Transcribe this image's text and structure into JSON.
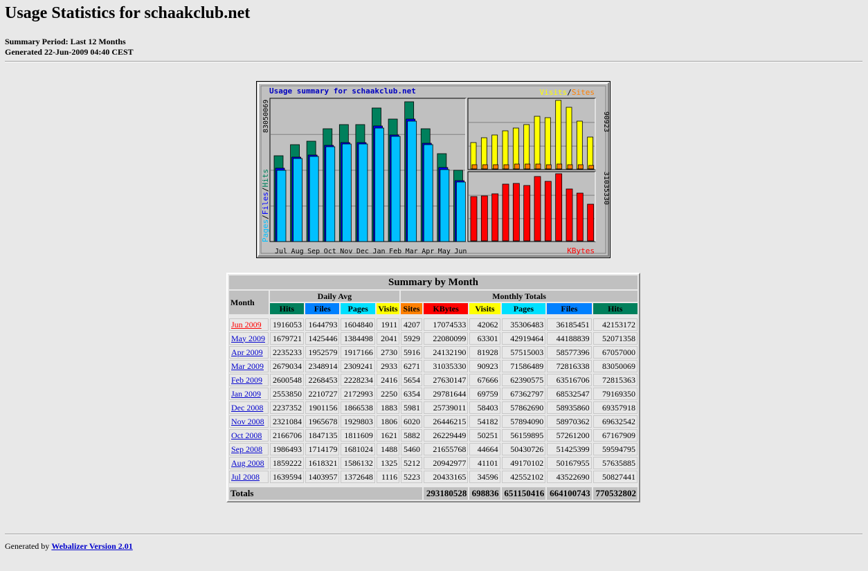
{
  "header": {
    "title": "Usage Statistics for schaakclub.net",
    "period": "Summary Period: Last 12 Months",
    "generated": "Generated 22-Jun-2009 04:40 CEST"
  },
  "graph": {
    "title": "Usage summary for schaakclub.net",
    "left_legend": [
      "Pages",
      "/",
      "Files",
      "/",
      "Hits"
    ],
    "right_top_legend": [
      "Visits",
      "/",
      "Sites"
    ],
    "right_bottom_legend": "KBytes",
    "left_max_label": "83050069",
    "right_top_max_label": "90923",
    "right_bottom_max_label": "31035330",
    "colors": {
      "hits": "#00805c",
      "files": "#0000ff",
      "pages": "#00c0ff",
      "visits": "#ffff00",
      "sites": "#ff8000",
      "kbytes": "#ff0000",
      "title": "#0000c0"
    }
  },
  "chart_data": {
    "type": "bar",
    "categories": [
      "Jul",
      "Aug",
      "Sep",
      "Oct",
      "Nov",
      "Dec",
      "Jan",
      "Feb",
      "Mar",
      "Apr",
      "May",
      "Jun"
    ],
    "series": [
      {
        "name": "Hits",
        "values": [
          50827441,
          57635885,
          59594795,
          67167909,
          69632542,
          69357918,
          79169350,
          72815363,
          83050069,
          67057000,
          52071358,
          42153172
        ]
      },
      {
        "name": "Files",
        "values": [
          43522690,
          50167955,
          51425399,
          57261200,
          58970362,
          58935860,
          68532547,
          63516706,
          72816338,
          58577396,
          44188839,
          36185451
        ]
      },
      {
        "name": "Pages",
        "values": [
          42552102,
          49170102,
          50430726,
          56159895,
          57894090,
          57862690,
          67362797,
          62390575,
          71586489,
          57515003,
          42919464,
          35306483
        ]
      },
      {
        "name": "Visits",
        "values": [
          34596,
          41101,
          44664,
          50251,
          54182,
          58403,
          69759,
          67666,
          90923,
          81928,
          63301,
          42062
        ]
      },
      {
        "name": "Sites",
        "values": [
          5223,
          5212,
          5460,
          5882,
          6020,
          5981,
          6354,
          5654,
          6271,
          5916,
          5929,
          4207
        ]
      },
      {
        "name": "KBytes",
        "values": [
          20433165,
          20942977,
          21655768,
          26229449,
          26446215,
          25739011,
          29781644,
          27630147,
          31035330,
          24132190,
          22080099,
          17074533
        ]
      }
    ],
    "ylim_left": [
      0,
      83050069
    ],
    "ylim_visits": [
      0,
      90923
    ],
    "ylim_kbytes": [
      0,
      31035330
    ],
    "grid": true
  },
  "table": {
    "caption": "Summary by Month",
    "month_header": "Month",
    "daily_avg_header": "Daily Avg",
    "monthly_totals_header": "Monthly Totals",
    "daily_cols": [
      {
        "label": "Hits",
        "color": "#00805c"
      },
      {
        "label": "Files",
        "color": "#0080ff"
      },
      {
        "label": "Pages",
        "color": "#00e0ff"
      },
      {
        "label": "Visits",
        "color": "#ffff00"
      }
    ],
    "monthly_cols": [
      {
        "label": "Sites",
        "color": "#ff8000"
      },
      {
        "label": "KBytes",
        "color": "#ff0000"
      },
      {
        "label": "Visits",
        "color": "#ffff00"
      },
      {
        "label": "Pages",
        "color": "#00e0ff"
      },
      {
        "label": "Files",
        "color": "#0080ff"
      },
      {
        "label": "Hits",
        "color": "#00805c"
      }
    ],
    "rows": [
      {
        "month": "Jun 2009",
        "current": true,
        "values": [
          "1916053",
          "1644793",
          "1604840",
          "1911",
          "4207",
          "17074533",
          "42062",
          "35306483",
          "36185451",
          "42153172"
        ]
      },
      {
        "month": "May 2009",
        "values": [
          "1679721",
          "1425446",
          "1384498",
          "2041",
          "5929",
          "22080099",
          "63301",
          "42919464",
          "44188839",
          "52071358"
        ]
      },
      {
        "month": "Apr 2009",
        "values": [
          "2235233",
          "1952579",
          "1917166",
          "2730",
          "5916",
          "24132190",
          "81928",
          "57515003",
          "58577396",
          "67057000"
        ]
      },
      {
        "month": "Mar 2009",
        "values": [
          "2679034",
          "2348914",
          "2309241",
          "2933",
          "6271",
          "31035330",
          "90923",
          "71586489",
          "72816338",
          "83050069"
        ]
      },
      {
        "month": "Feb 2009",
        "values": [
          "2600548",
          "2268453",
          "2228234",
          "2416",
          "5654",
          "27630147",
          "67666",
          "62390575",
          "63516706",
          "72815363"
        ]
      },
      {
        "month": "Jan 2009",
        "values": [
          "2553850",
          "2210727",
          "2172993",
          "2250",
          "6354",
          "29781644",
          "69759",
          "67362797",
          "68532547",
          "79169350"
        ]
      },
      {
        "month": "Dec 2008",
        "values": [
          "2237352",
          "1901156",
          "1866538",
          "1883",
          "5981",
          "25739011",
          "58403",
          "57862690",
          "58935860",
          "69357918"
        ]
      },
      {
        "month": "Nov 2008",
        "values": [
          "2321084",
          "1965678",
          "1929803",
          "1806",
          "6020",
          "26446215",
          "54182",
          "57894090",
          "58970362",
          "69632542"
        ]
      },
      {
        "month": "Oct 2008",
        "values": [
          "2166706",
          "1847135",
          "1811609",
          "1621",
          "5882",
          "26229449",
          "50251",
          "56159895",
          "57261200",
          "67167909"
        ]
      },
      {
        "month": "Sep 2008",
        "values": [
          "1986493",
          "1714179",
          "1681024",
          "1488",
          "5460",
          "21655768",
          "44664",
          "50430726",
          "51425399",
          "59594795"
        ]
      },
      {
        "month": "Aug 2008",
        "values": [
          "1859222",
          "1618321",
          "1586132",
          "1325",
          "5212",
          "20942977",
          "41101",
          "49170102",
          "50167955",
          "57635885"
        ]
      },
      {
        "month": "Jul 2008",
        "values": [
          "1639594",
          "1403957",
          "1372648",
          "1116",
          "5223",
          "20433165",
          "34596",
          "42552102",
          "43522690",
          "50827441"
        ]
      }
    ],
    "totals_label": "Totals",
    "totals": [
      "293180528",
      "698836",
      "651150416",
      "664100743",
      "770532802"
    ]
  },
  "footer": {
    "prefix": "Generated by ",
    "link": "Webalizer Version 2.01"
  }
}
